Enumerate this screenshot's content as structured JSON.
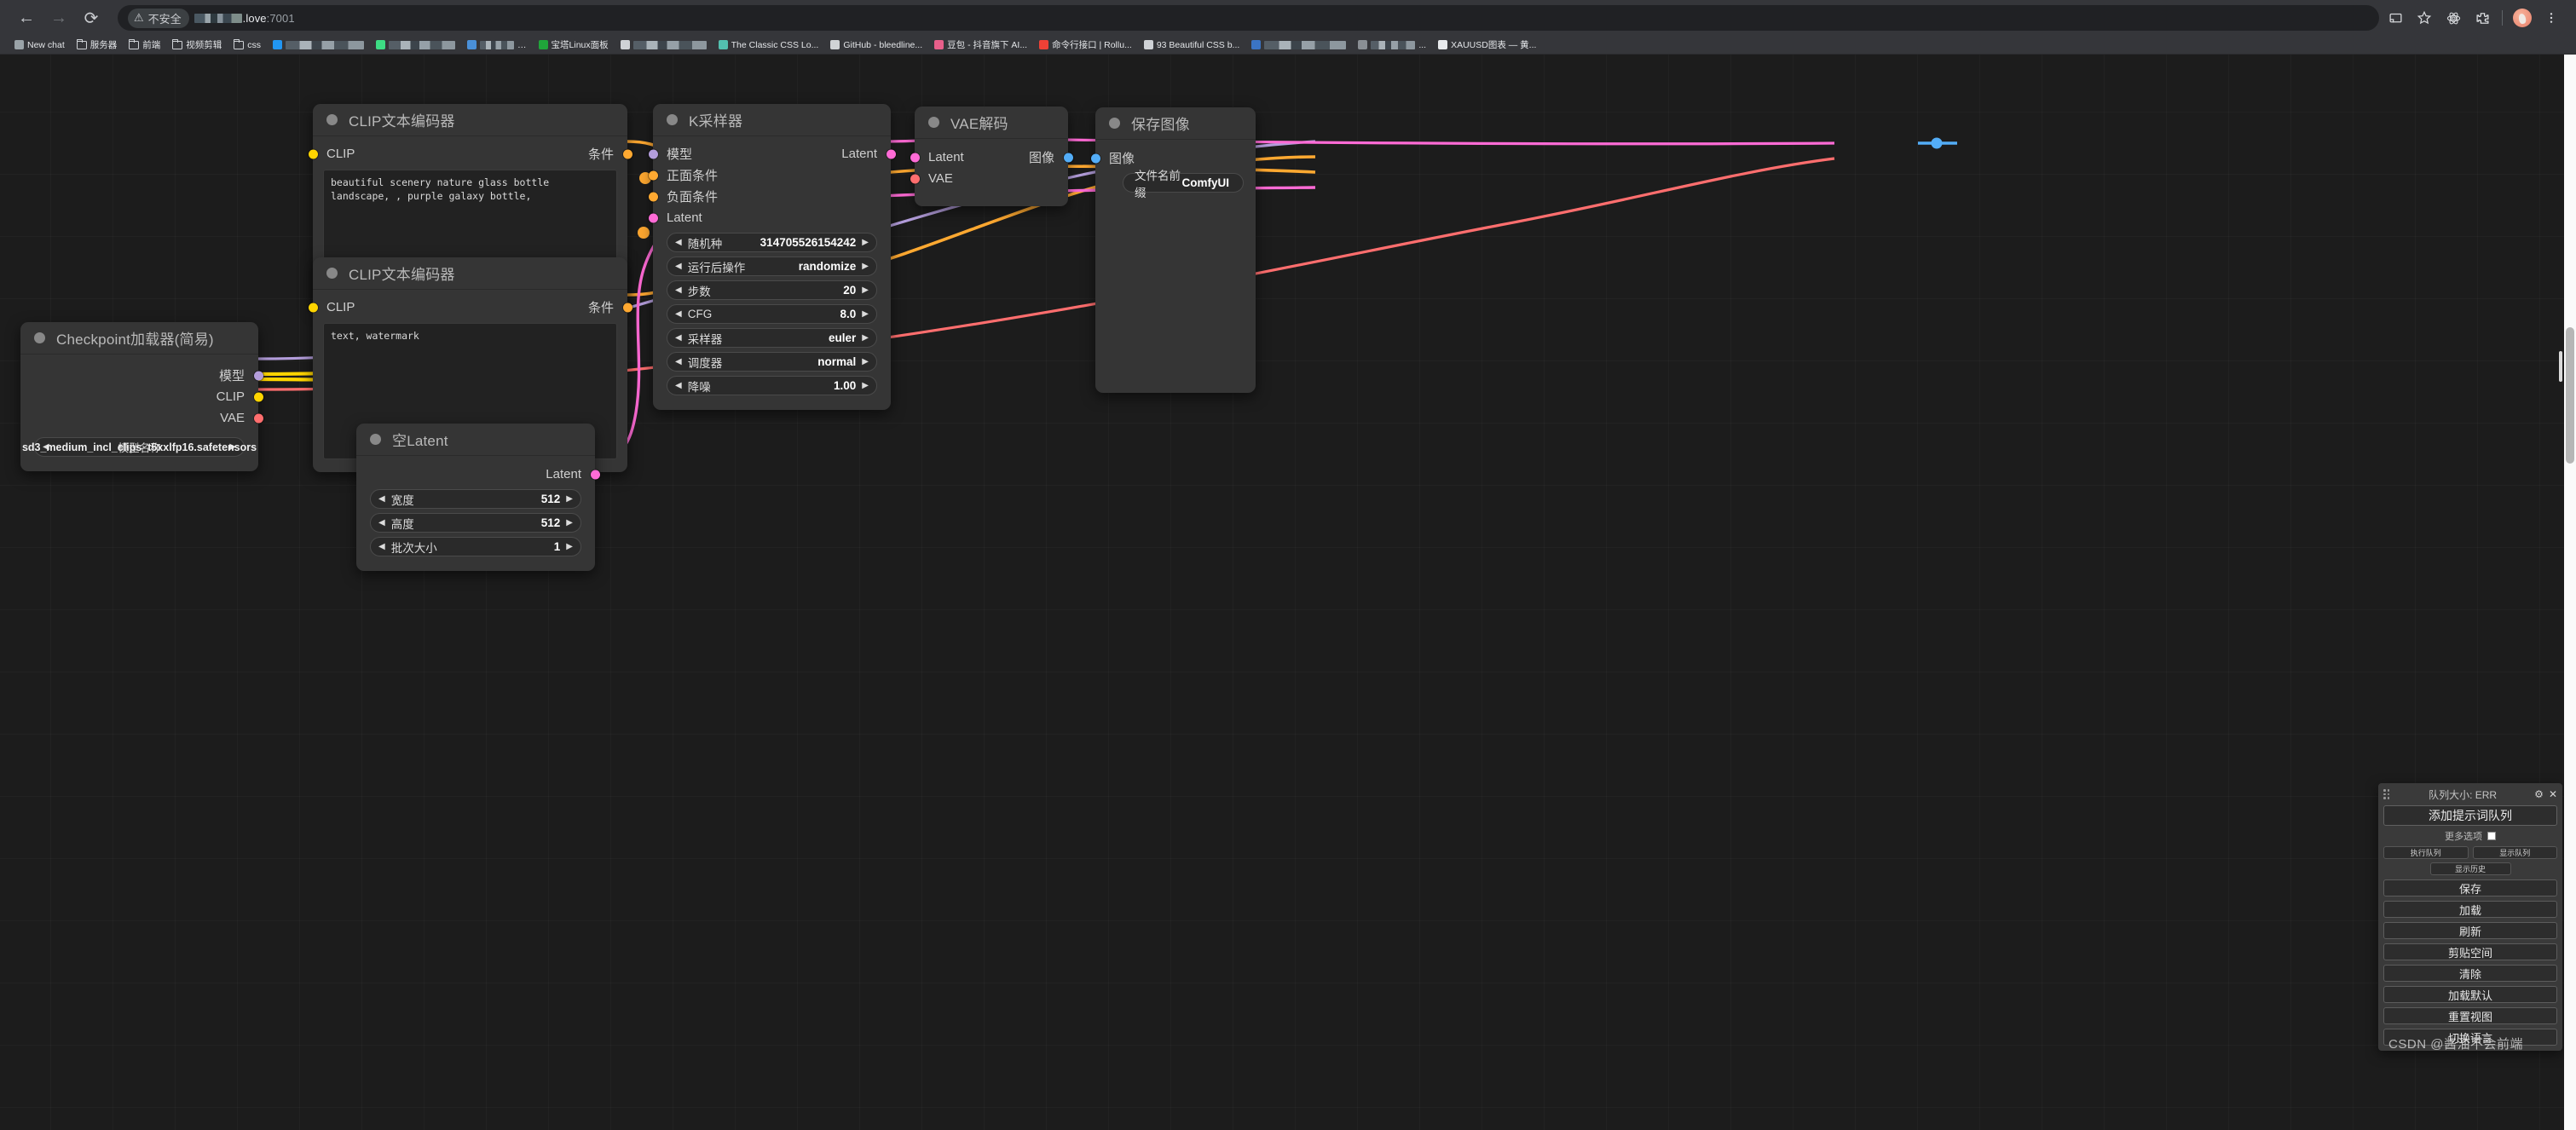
{
  "browser": {
    "nav": {
      "back": "←",
      "forward": "→",
      "reload": "⟳"
    },
    "security_label": "不安全",
    "security_icon": "⚠",
    "url_host_suffix": ".love",
    "url_port": ":7001",
    "toolbar_icons": [
      "cast-icon",
      "bookmark-star-icon",
      "extensions-atom-icon",
      "extensions-puzzle-icon",
      "profile-avatar",
      "more-menu-icon"
    ],
    "bookmarks": [
      {
        "label": "New chat",
        "icon": "chatgpt-icon",
        "type": "site",
        "color": "#9aa3a8"
      },
      {
        "label": "服务器",
        "type": "folder"
      },
      {
        "label": "前端",
        "type": "folder"
      },
      {
        "label": "视频剪辑",
        "type": "folder"
      },
      {
        "label": "css",
        "type": "folder"
      },
      {
        "label": "",
        "type": "redacted",
        "icon": "maven-icon",
        "color": "#2196f3",
        "width": 92
      },
      {
        "label": "",
        "type": "redacted",
        "icon": "green-icon",
        "color": "#3ddc84",
        "width": 78
      },
      {
        "label": "…",
        "type": "redacted-short",
        "icon": "blue-icon",
        "color": "#4a90d9",
        "width": 40
      },
      {
        "label": "宝塔Linux面板",
        "type": "site",
        "icon": "bt-panel-icon",
        "color": "#20a53a"
      },
      {
        "label": "",
        "type": "redacted",
        "icon": "doc-icon",
        "color": "#cfd2d6",
        "width": 86
      },
      {
        "label": "The Classic CSS Lo...",
        "type": "site",
        "icon": "css-icon",
        "color": "#53c0b0"
      },
      {
        "label": "GitHub - bleedline...",
        "type": "site",
        "icon": "github-icon",
        "color": "#d0d3d6"
      },
      {
        "label": "豆包 - 抖音旗下 AI...",
        "type": "site",
        "icon": "doubao-icon",
        "color": "#e85f8a"
      },
      {
        "label": "命令行接口 | Rollu...",
        "type": "site",
        "icon": "rollup-icon",
        "color": "#ef4136"
      },
      {
        "label": "93 Beautiful CSS b...",
        "type": "site",
        "icon": "cursor-icon",
        "color": "#cfd2d6"
      },
      {
        "label": "",
        "type": "redacted",
        "icon": "blue2-icon",
        "color": "#3b74c4",
        "width": 96
      },
      {
        "label": "...",
        "type": "redacted-short",
        "icon": "grey-icon",
        "color": "#8a8f94",
        "width": 52
      },
      {
        "label": "XAUUSD图表 — 黄...",
        "type": "site",
        "icon": "tradingview-icon",
        "color": "#e8eaed"
      }
    ]
  },
  "colors": {
    "clip": "#FFD500",
    "conditioning": "#FFA931",
    "model": "#B39DDB",
    "latent": "#FF6BD6",
    "vae": "#FF6E6E",
    "image": "#53adf7",
    "canvas_bg": "#1c1c1c",
    "node_bg": "#353535"
  },
  "nodes": {
    "checkpoint_loader": {
      "title": "Checkpoint加载器(简易)",
      "outputs": [
        "模型",
        "CLIP",
        "VAE"
      ],
      "widget": {
        "label": "模型名称",
        "value": "sd3_medium_incl_clips_t5xxlfp16.safetensors",
        "arrow_left": "◀",
        "arrow_right": "▶"
      }
    },
    "clip_positive": {
      "title": "CLIP文本编码器",
      "input": "CLIP",
      "output": "条件",
      "text": "beautiful scenery nature glass bottle landscape, , purple galaxy bottle,"
    },
    "clip_negative": {
      "title": "CLIP文本编码器",
      "input": "CLIP",
      "output": "条件",
      "text": "text, watermark"
    },
    "empty_latent": {
      "title": "空Latent",
      "output": "Latent",
      "widgets": [
        {
          "label": "宽度",
          "value": "512"
        },
        {
          "label": "高度",
          "value": "512"
        },
        {
          "label": "批次大小",
          "value": "1"
        }
      ]
    },
    "ksampler": {
      "title": "K采样器",
      "inputs": [
        "模型",
        "正面条件",
        "负面条件",
        "Latent"
      ],
      "output": "Latent",
      "widgets": [
        {
          "label": "随机种",
          "value": "314705526154242"
        },
        {
          "label": "运行后操作",
          "value": "randomize"
        },
        {
          "label": "步数",
          "value": "20"
        },
        {
          "label": "CFG",
          "value": "8.0"
        },
        {
          "label": "采样器",
          "value": "euler"
        },
        {
          "label": "调度器",
          "value": "normal"
        },
        {
          "label": "降噪",
          "value": "1.00"
        }
      ]
    },
    "vae_decode": {
      "title": "VAE解码",
      "inputs": [
        "Latent",
        "VAE"
      ],
      "output": "图像"
    },
    "save_image": {
      "title": "保存图像",
      "input": "图像",
      "widget": {
        "label": "文件名前缀",
        "value": "ComfyUI"
      }
    }
  },
  "queue_panel": {
    "title": "队列大小: ERR",
    "gear_icon": "⚙",
    "close_icon": "✕",
    "add_prompt": "添加提示词队列",
    "more_options": "更多选项",
    "run_queue": "执行队列",
    "show_queue": "显示队列",
    "show_history": "显示历史",
    "buttons": [
      "保存",
      "加载",
      "刷新",
      "剪贴空间",
      "清除",
      "加载默认",
      "重置视图",
      "切换语言"
    ]
  },
  "watermark": "CSDN @酱油不会前端"
}
